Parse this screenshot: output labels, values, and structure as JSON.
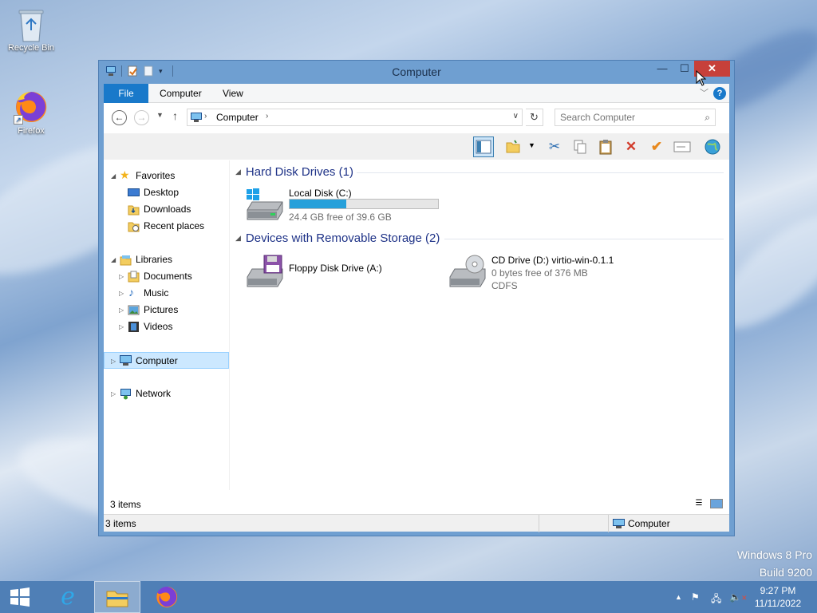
{
  "desktop": {
    "icons": [
      {
        "label": "Recycle Bin",
        "icon": "recycle-bin-icon"
      },
      {
        "label": "Firefox",
        "icon": "firefox-icon"
      }
    ],
    "watermark": {
      "line1": "Windows 8 Pro",
      "line2": "Build 9200"
    }
  },
  "window": {
    "title": "Computer",
    "controls": {
      "minimize": "—",
      "maximize": "☐",
      "close": "✕"
    },
    "ribbon": {
      "tabs": [
        "File",
        "Computer",
        "View"
      ],
      "help": "?"
    },
    "address": {
      "crumb": "Computer",
      "search_placeholder": "Search Computer"
    },
    "nav": {
      "favorites": {
        "label": "Favorites",
        "items": [
          "Desktop",
          "Downloads",
          "Recent places"
        ]
      },
      "libraries": {
        "label": "Libraries",
        "items": [
          "Documents",
          "Music",
          "Pictures",
          "Videos"
        ]
      },
      "computer": "Computer",
      "network": "Network"
    },
    "groups": {
      "hdd": {
        "header": "Hard Disk Drives (1)",
        "drives": [
          {
            "name": "Local Disk (C:)",
            "free_text": "24.4 GB free of 39.6 GB",
            "used_fraction": 0.384
          }
        ]
      },
      "removable": {
        "header": "Devices with Removable Storage (2)",
        "drives": [
          {
            "name": "Floppy Disk Drive (A:)"
          },
          {
            "name": "CD Drive (D:) virtio-win-0.1.1",
            "free_text": "0 bytes free of 376 MB",
            "fs": "CDFS"
          }
        ]
      }
    },
    "item_count": "3 items",
    "status": {
      "left": "3 items",
      "right": "Computer"
    }
  },
  "taskbar": {
    "clock_time": "9:27 PM",
    "clock_date": "11/11/2022"
  },
  "colors": {
    "accent": "#1979ca",
    "close": "#c7403a",
    "progress": "#26a0da",
    "taskbar": "#4f7fb6"
  }
}
